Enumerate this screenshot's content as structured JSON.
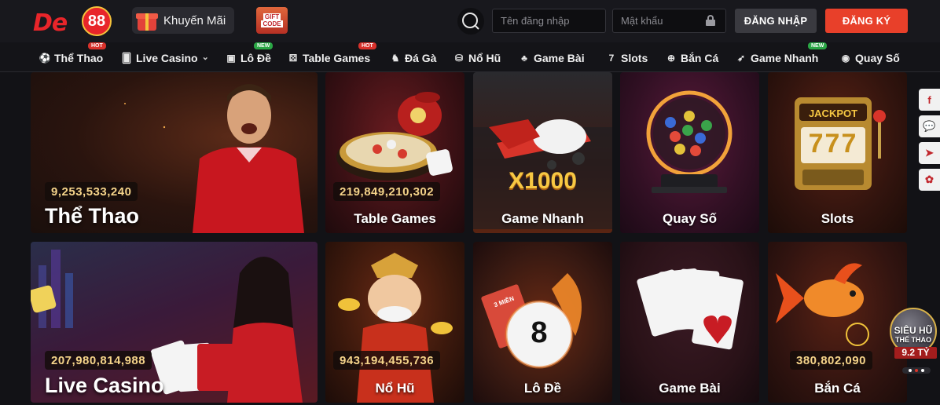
{
  "header": {
    "logo_text": "De",
    "logo_number": "88",
    "promo_label": "Khuyến Mãi",
    "gift_code_top": "GIFT",
    "gift_code_bottom": "CODE",
    "username_placeholder": "Tên đăng nhập",
    "password_placeholder": "Mật khẩu",
    "login_label": "ĐĂNG NHẬP",
    "register_label": "ĐĂNG KÝ"
  },
  "nav": {
    "items": [
      {
        "label": "Thể Thao",
        "icon": "soccer-ball-icon",
        "glyph": "⚽",
        "tag": "HOT"
      },
      {
        "label": "Live Casino",
        "icon": "cards-icon",
        "glyph": "🂠",
        "tag": "",
        "dropdown": "⌄"
      },
      {
        "label": "Lô Đề",
        "icon": "lottery-icon",
        "glyph": "▣",
        "tag": "NEW"
      },
      {
        "label": "Table Games",
        "icon": "dice-icon",
        "glyph": "⚄",
        "tag": "HOT"
      },
      {
        "label": "Đá Gà",
        "icon": "rooster-icon",
        "glyph": "♞",
        "tag": ""
      },
      {
        "label": "Nổ Hũ",
        "icon": "jar-icon",
        "glyph": "⛁",
        "tag": ""
      },
      {
        "label": "Game Bài",
        "icon": "club-icon",
        "glyph": "♣",
        "tag": ""
      },
      {
        "label": "Slots",
        "icon": "seven-icon",
        "glyph": "7",
        "tag": ""
      },
      {
        "label": "Bắn Cá",
        "icon": "crosshair-icon",
        "glyph": "⊕",
        "tag": ""
      },
      {
        "label": "Game Nhanh",
        "icon": "rocket-icon",
        "glyph": "➶",
        "tag": "NEW"
      },
      {
        "label": "Quay Số",
        "icon": "number-ball-icon",
        "glyph": "◉",
        "tag": ""
      }
    ]
  },
  "tiles": {
    "the_thao": {
      "label": "Thể Thao",
      "jackpot": "9,253,533,240"
    },
    "table_games": {
      "label": "Table Games",
      "jackpot": "219,849,210,302"
    },
    "game_nhanh": {
      "label": "Game Nhanh",
      "multiplier": "X1000"
    },
    "quay_so": {
      "label": "Quay Số"
    },
    "slots": {
      "label": "Slots",
      "sign": "JACKPOT",
      "reels": "777"
    },
    "live_casino": {
      "label": "Live Casino",
      "jackpot": "207,980,814,988"
    },
    "no_hu": {
      "label": "Nổ Hũ",
      "jackpot": "943,194,455,736"
    },
    "lo_de": {
      "label": "Lô Đề",
      "ball": "8",
      "ticket": "3 MIỀN"
    },
    "game_bai": {
      "label": "Game Bài"
    },
    "ban_ca": {
      "label": "Bắn Cá",
      "jackpot": "380,802,090"
    }
  },
  "side_social": [
    "f",
    "💬",
    "➤",
    "✿"
  ],
  "sieu_hu": {
    "title": "SIÊU HŨ",
    "subtitle": "THỂ THAO",
    "value": "9.2 TỶ"
  },
  "colors": {
    "brand_red": "#e8402a",
    "accent_gold": "#f5d48a",
    "bg": "#121216"
  }
}
